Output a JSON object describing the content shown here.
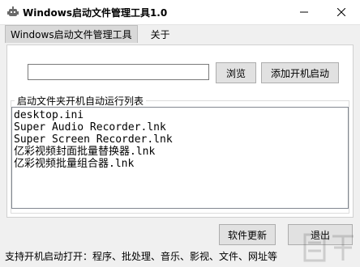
{
  "window": {
    "title": "Windows启动文件管理工具1.0"
  },
  "tabs": [
    {
      "label": "Windows启动文件管理工具"
    },
    {
      "label": "关于"
    }
  ],
  "input": {
    "value": ""
  },
  "buttons": {
    "browse": "浏览",
    "add_startup": "添加开机启动",
    "update": "软件更新",
    "exit": "退出"
  },
  "group": {
    "title": "启动文件夹开机自动运行列表"
  },
  "list_items": [
    "desktop.ini",
    "Super Audio Recorder.lnk",
    "Super Screen Recorder.lnk",
    "亿彩视频封面批量替换器.lnk",
    "亿彩视频批量组合器.lnk"
  ],
  "status": {
    "text": "支持开机启动打开：程序、批处理、音乐、影视、文件、网址等"
  },
  "colors": {
    "window_bg": "#f0f0f0",
    "button_bg": "#e1e1e1",
    "button_border": "#adadad"
  },
  "icons": {
    "app": "robot-icon",
    "minimize": "minimize-icon",
    "close": "close-icon"
  }
}
